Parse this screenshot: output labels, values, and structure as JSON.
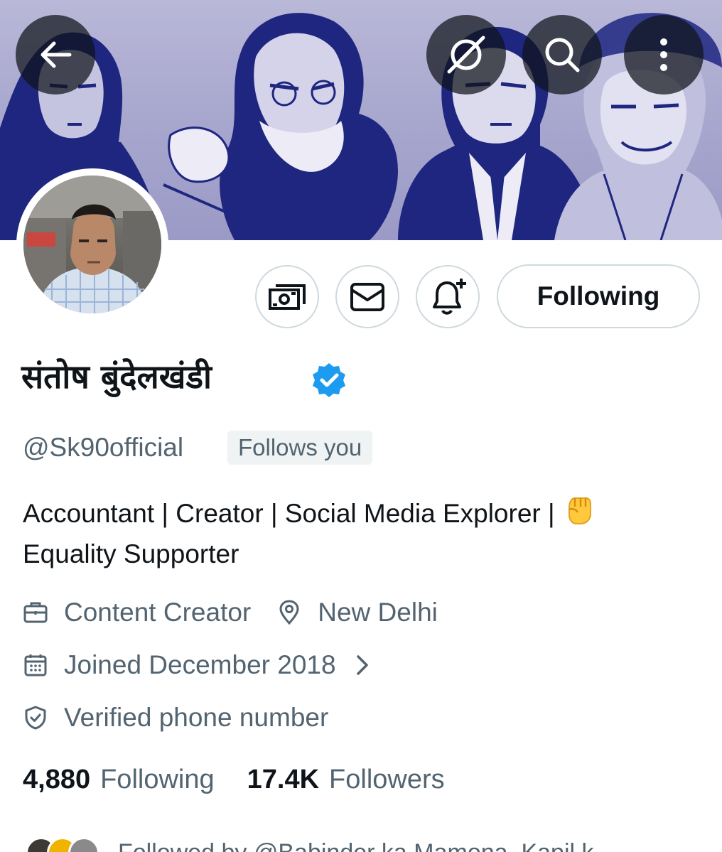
{
  "header": {
    "back_icon": "arrow-left-icon",
    "grok_icon": "grok-slash-icon",
    "search_icon": "search-icon",
    "more_icon": "more-vertical-icon"
  },
  "profile": {
    "display_name": "संतोष बुंदेलखंडी",
    "verified": true,
    "handle": "@Sk90official",
    "follows_you": "Follows you",
    "bio_line1": "Accountant | Creator | Social Media Explorer |",
    "bio_emoji": "raised-fist",
    "bio_line2": "Equality Supporter",
    "category": "Content Creator",
    "location": "New Delhi",
    "joined": "Joined December 2018",
    "verified_phone": "Verified phone number"
  },
  "actions": {
    "tip_icon": "money-icon",
    "message_icon": "mail-icon",
    "notify_icon": "bell-plus-icon",
    "follow_label": "Following"
  },
  "stats": {
    "following_count": "4,880",
    "following_label": "Following",
    "followers_count": "17.4K",
    "followers_label": "Followers"
  },
  "followed_by": {
    "text": "Followed by @Babinder ka Mamona, Kapil k..."
  },
  "colors": {
    "accent_blue": "#1d9bf0",
    "banner_navy": "#1f2680",
    "secondary_text": "#536471",
    "border": "#cfd9de"
  }
}
